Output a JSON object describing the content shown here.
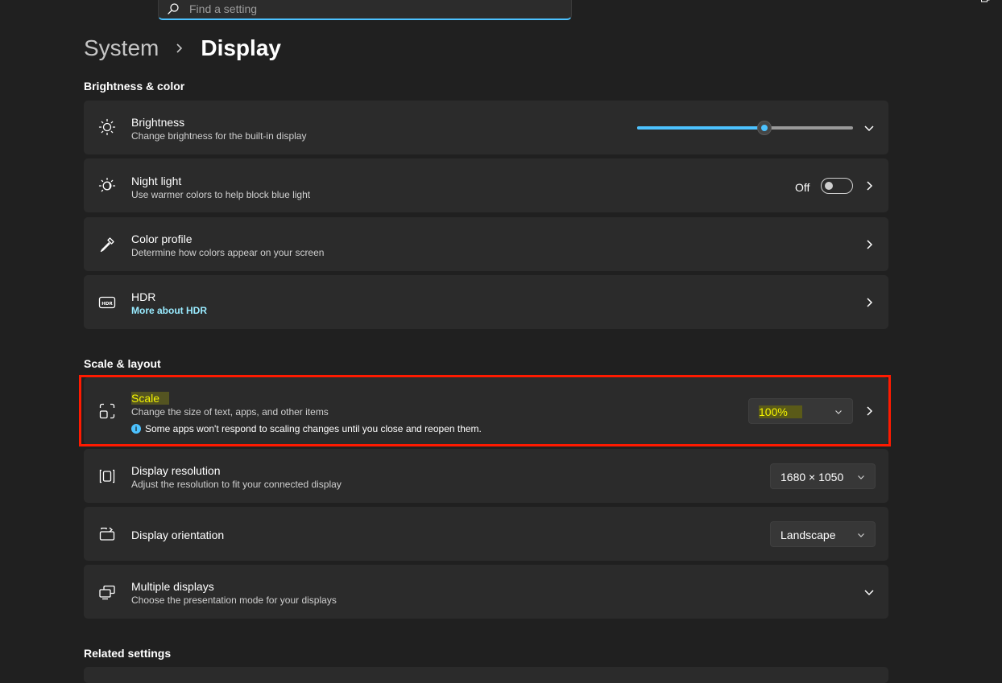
{
  "search": {
    "placeholder": "Find a setting"
  },
  "breadcrumb": {
    "parent": "System",
    "current": "Display"
  },
  "sections": {
    "brightness_color": "Brightness & color",
    "scale_layout": "Scale & layout",
    "related": "Related settings"
  },
  "brightness": {
    "title": "Brightness",
    "subtitle": "Change brightness for the built-in display",
    "level": 0.59
  },
  "night_light": {
    "title": "Night light",
    "subtitle": "Use warmer colors to help block blue light",
    "state": "Off"
  },
  "color_profile": {
    "title": "Color profile",
    "subtitle": "Determine how colors appear on your screen"
  },
  "hdr": {
    "title": "HDR",
    "link": "More about HDR"
  },
  "scale": {
    "title": "Scale",
    "subtitle": "Change the size of text, apps, and other items",
    "note": "Some apps won't respond to scaling changes until you close and reopen them.",
    "info_glyph": "i",
    "value": "100%"
  },
  "resolution": {
    "title": "Display resolution",
    "subtitle": "Adjust the resolution to fit your connected display",
    "value": "1680 × 1050"
  },
  "orientation": {
    "title": "Display orientation",
    "value": "Landscape"
  },
  "multiple": {
    "title": "Multiple displays",
    "subtitle": "Choose the presentation mode for your displays"
  },
  "colors": {
    "accent": "#4cc2ff",
    "highlight_border": "#ff1a00",
    "highlight_text": "#f5f500",
    "card": "#2b2b2b",
    "background": "#202020"
  }
}
